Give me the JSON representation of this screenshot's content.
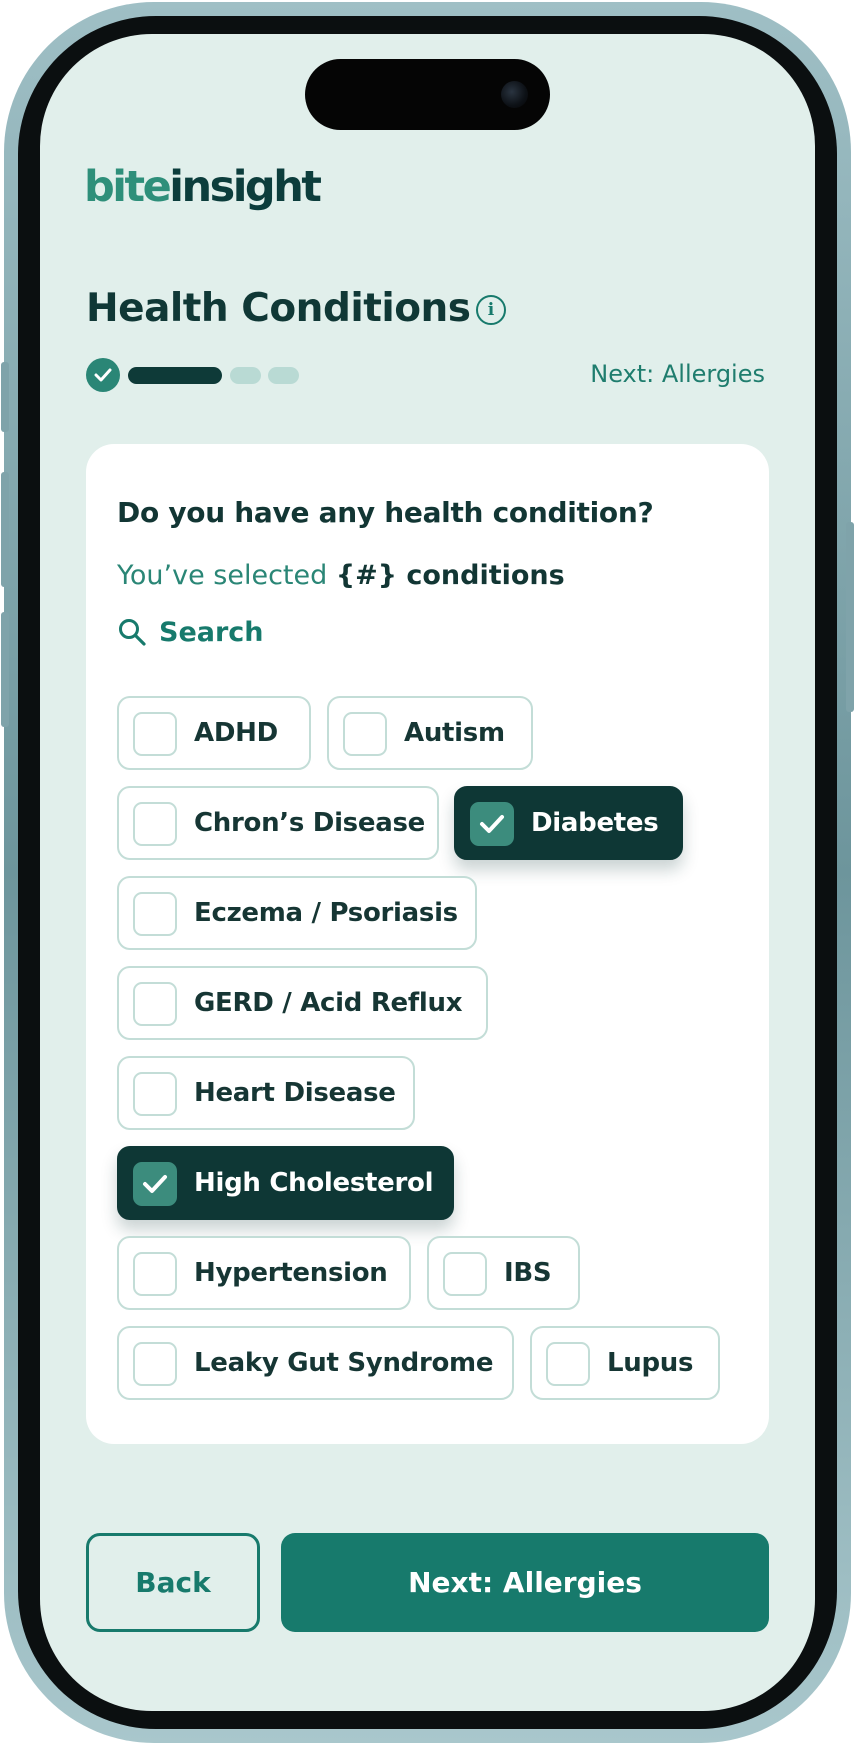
{
  "app": {
    "logo_bite": "bite",
    "logo_insight": "insight",
    "accent_color": "#177a6c",
    "dark_color": "#0e3735",
    "background_color": "#e1efeb"
  },
  "header": {
    "title": "Health Conditions",
    "info_icon": "info-icon",
    "next_hint": "Next: Allergies"
  },
  "progress": {
    "completed_steps": 1,
    "current_step": 2,
    "total_steps": 4
  },
  "card": {
    "question": "Do you have any health condition?",
    "selected_prefix": "You’ve selected ",
    "selected_count": "{#}",
    "selected_suffix": " conditions",
    "search_label": "Search",
    "search_icon": "search-icon"
  },
  "conditions": [
    {
      "label": "ADHD",
      "checked": false
    },
    {
      "label": "Autism",
      "checked": false
    },
    {
      "label": "Chron’s Disease",
      "checked": false
    },
    {
      "label": "Diabetes",
      "checked": true
    },
    {
      "label": "Eczema / Psoriasis",
      "checked": false
    },
    {
      "label": "GERD / Acid Reflux",
      "checked": false
    },
    {
      "label": "Heart Disease",
      "checked": false
    },
    {
      "label": "High Cholesterol",
      "checked": true
    },
    {
      "label": "Hypertension",
      "checked": false
    },
    {
      "label": "IBS",
      "checked": false
    },
    {
      "label": "Leaky Gut Syndrome",
      "checked": false
    },
    {
      "label": "Lupus",
      "checked": false
    }
  ],
  "footer": {
    "back_label": "Back",
    "next_label": "Next: Allergies"
  }
}
